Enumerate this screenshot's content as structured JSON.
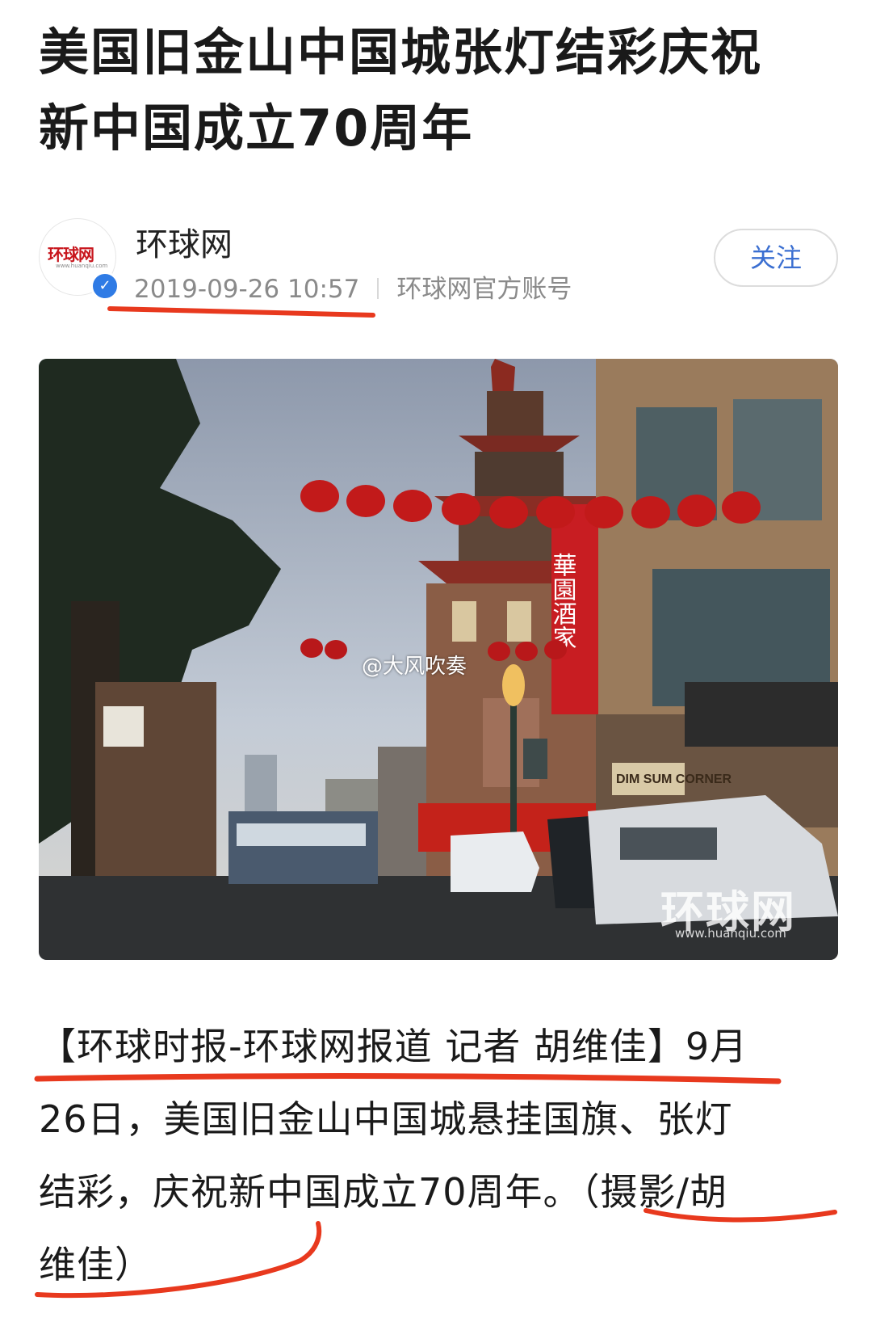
{
  "article": {
    "title_line1": "美国旧金山中国城张灯结彩庆祝",
    "title_line2": "新中国成立70周年"
  },
  "author": {
    "name": "环球网",
    "avatar_logo_text": "环球网",
    "avatar_logo_url": "www.huanqiu.com",
    "datetime": "2019-09-26 10:57",
    "account_type": "环球网官方账号",
    "follow_label": "关注"
  },
  "photo": {
    "weibo_watermark": "@大风吹奏",
    "brand_watermark": "环球网",
    "brand_url": "www.huanqiu.com",
    "sign_text": "華園酒家",
    "shop_sign": "DIM SUM CORNER"
  },
  "body": {
    "line1": "【环球时报-环球网报道 记者 胡维佳】9月",
    "line2": "26日，美国旧金山中国城悬挂国旗、张灯",
    "line3": "结彩，庆祝新中国成立70周年。（摄影/胡",
    "line4": "维佳）"
  },
  "colors": {
    "underline_red": "#e8391e",
    "follow_blue": "#3b6fd1",
    "verified_blue": "#2f7be5",
    "meta_gray": "#8a8a8a"
  }
}
